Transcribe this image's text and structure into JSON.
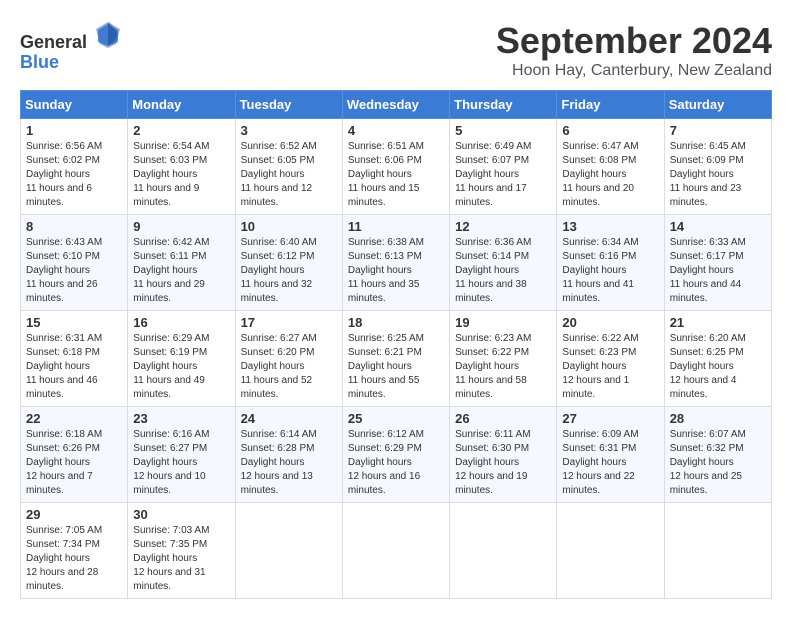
{
  "header": {
    "logo_general": "General",
    "logo_blue": "Blue",
    "month_title": "September 2024",
    "location": "Hoon Hay, Canterbury, New Zealand"
  },
  "weekdays": [
    "Sunday",
    "Monday",
    "Tuesday",
    "Wednesday",
    "Thursday",
    "Friday",
    "Saturday"
  ],
  "weeks": [
    [
      {
        "day": "1",
        "sunrise": "6:56 AM",
        "sunset": "6:02 PM",
        "daylight": "11 hours and 6 minutes."
      },
      {
        "day": "2",
        "sunrise": "6:54 AM",
        "sunset": "6:03 PM",
        "daylight": "11 hours and 9 minutes."
      },
      {
        "day": "3",
        "sunrise": "6:52 AM",
        "sunset": "6:05 PM",
        "daylight": "11 hours and 12 minutes."
      },
      {
        "day": "4",
        "sunrise": "6:51 AM",
        "sunset": "6:06 PM",
        "daylight": "11 hours and 15 minutes."
      },
      {
        "day": "5",
        "sunrise": "6:49 AM",
        "sunset": "6:07 PM",
        "daylight": "11 hours and 17 minutes."
      },
      {
        "day": "6",
        "sunrise": "6:47 AM",
        "sunset": "6:08 PM",
        "daylight": "11 hours and 20 minutes."
      },
      {
        "day": "7",
        "sunrise": "6:45 AM",
        "sunset": "6:09 PM",
        "daylight": "11 hours and 23 minutes."
      }
    ],
    [
      {
        "day": "8",
        "sunrise": "6:43 AM",
        "sunset": "6:10 PM",
        "daylight": "11 hours and 26 minutes."
      },
      {
        "day": "9",
        "sunrise": "6:42 AM",
        "sunset": "6:11 PM",
        "daylight": "11 hours and 29 minutes."
      },
      {
        "day": "10",
        "sunrise": "6:40 AM",
        "sunset": "6:12 PM",
        "daylight": "11 hours and 32 minutes."
      },
      {
        "day": "11",
        "sunrise": "6:38 AM",
        "sunset": "6:13 PM",
        "daylight": "11 hours and 35 minutes."
      },
      {
        "day": "12",
        "sunrise": "6:36 AM",
        "sunset": "6:14 PM",
        "daylight": "11 hours and 38 minutes."
      },
      {
        "day": "13",
        "sunrise": "6:34 AM",
        "sunset": "6:16 PM",
        "daylight": "11 hours and 41 minutes."
      },
      {
        "day": "14",
        "sunrise": "6:33 AM",
        "sunset": "6:17 PM",
        "daylight": "11 hours and 44 minutes."
      }
    ],
    [
      {
        "day": "15",
        "sunrise": "6:31 AM",
        "sunset": "6:18 PM",
        "daylight": "11 hours and 46 minutes."
      },
      {
        "day": "16",
        "sunrise": "6:29 AM",
        "sunset": "6:19 PM",
        "daylight": "11 hours and 49 minutes."
      },
      {
        "day": "17",
        "sunrise": "6:27 AM",
        "sunset": "6:20 PM",
        "daylight": "11 hours and 52 minutes."
      },
      {
        "day": "18",
        "sunrise": "6:25 AM",
        "sunset": "6:21 PM",
        "daylight": "11 hours and 55 minutes."
      },
      {
        "day": "19",
        "sunrise": "6:23 AM",
        "sunset": "6:22 PM",
        "daylight": "11 hours and 58 minutes."
      },
      {
        "day": "20",
        "sunrise": "6:22 AM",
        "sunset": "6:23 PM",
        "daylight": "12 hours and 1 minute."
      },
      {
        "day": "21",
        "sunrise": "6:20 AM",
        "sunset": "6:25 PM",
        "daylight": "12 hours and 4 minutes."
      }
    ],
    [
      {
        "day": "22",
        "sunrise": "6:18 AM",
        "sunset": "6:26 PM",
        "daylight": "12 hours and 7 minutes."
      },
      {
        "day": "23",
        "sunrise": "6:16 AM",
        "sunset": "6:27 PM",
        "daylight": "12 hours and 10 minutes."
      },
      {
        "day": "24",
        "sunrise": "6:14 AM",
        "sunset": "6:28 PM",
        "daylight": "12 hours and 13 minutes."
      },
      {
        "day": "25",
        "sunrise": "6:12 AM",
        "sunset": "6:29 PM",
        "daylight": "12 hours and 16 minutes."
      },
      {
        "day": "26",
        "sunrise": "6:11 AM",
        "sunset": "6:30 PM",
        "daylight": "12 hours and 19 minutes."
      },
      {
        "day": "27",
        "sunrise": "6:09 AM",
        "sunset": "6:31 PM",
        "daylight": "12 hours and 22 minutes."
      },
      {
        "day": "28",
        "sunrise": "6:07 AM",
        "sunset": "6:32 PM",
        "daylight": "12 hours and 25 minutes."
      }
    ],
    [
      {
        "day": "29",
        "sunrise": "7:05 AM",
        "sunset": "7:34 PM",
        "daylight": "12 hours and 28 minutes."
      },
      {
        "day": "30",
        "sunrise": "7:03 AM",
        "sunset": "7:35 PM",
        "daylight": "12 hours and 31 minutes."
      },
      null,
      null,
      null,
      null,
      null
    ]
  ]
}
